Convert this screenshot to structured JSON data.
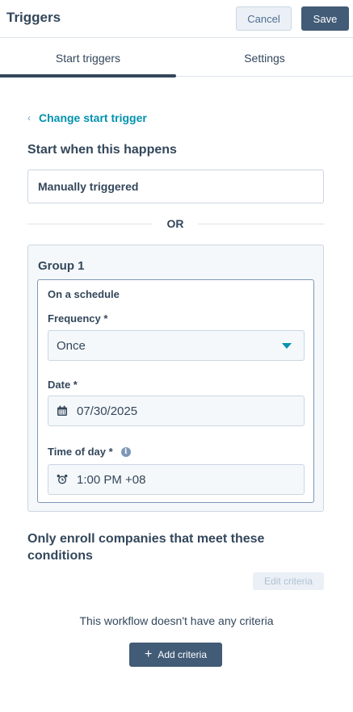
{
  "header": {
    "title": "Triggers",
    "cancel_label": "Cancel",
    "save_label": "Save"
  },
  "tabs": [
    {
      "label": "Start triggers",
      "active": true
    },
    {
      "label": "Settings",
      "active": false
    }
  ],
  "change_trigger_link": "Change start trigger",
  "start_section_title": "Start when this happens",
  "manual_trigger_label": "Manually triggered",
  "divider_text": "OR",
  "group": {
    "title": "Group 1",
    "trigger_card": {
      "title": "On a schedule",
      "frequency_label": "Frequency *",
      "frequency_value": "Once",
      "date_label": "Date *",
      "date_value": "07/30/2025",
      "time_label": "Time of day *",
      "time_value": "1:00 PM +08"
    }
  },
  "conditions": {
    "title": "Only enroll companies that meet these conditions",
    "edit_label": "Edit criteria",
    "empty_text": "This workflow doesn't have any criteria",
    "add_label": "Add criteria"
  },
  "icons": {
    "back": "chevron-left-icon",
    "dropdown": "caret-down-icon",
    "calendar": "calendar-icon",
    "alarm": "alarm-clock-icon",
    "info": "info-icon",
    "add": "plus-icon"
  },
  "colors": {
    "primary_dark": "#425b76",
    "link": "#0091ae",
    "text": "#33475b",
    "border": "#cbd6e2",
    "panel_bg": "#f5f8fa"
  }
}
